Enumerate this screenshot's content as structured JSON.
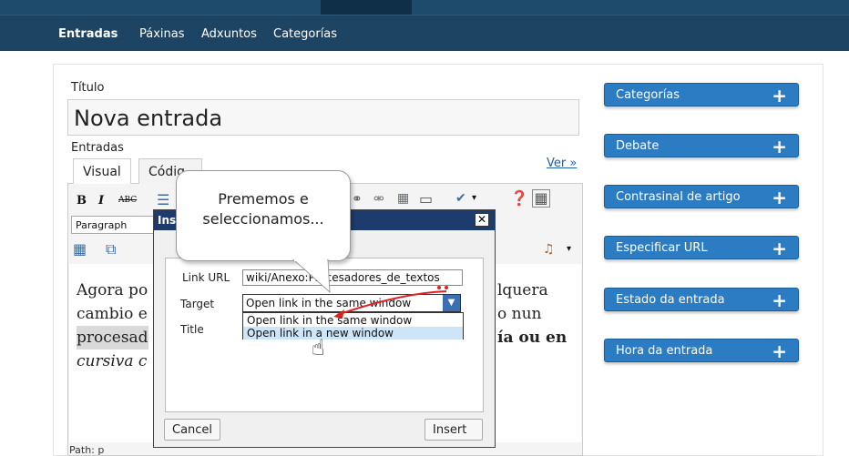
{
  "nav": {
    "items": [
      {
        "label": "Entradas"
      },
      {
        "label": "Páxinas"
      },
      {
        "label": "Adxuntos"
      },
      {
        "label": "Categorías"
      }
    ]
  },
  "post": {
    "title_label": "Título",
    "title_value": "Nova entrada",
    "content_label": "Entradas",
    "preview_link": "Ver »"
  },
  "editor": {
    "tabs": [
      "Visual",
      "Códig"
    ],
    "format_select": "Paragraph",
    "body_lines": [
      "Agora po",
      "cambio e",
      "procesad",
      "cursiva c"
    ],
    "body_right_lines": [
      "lquera",
      "o nun",
      "ía ou en"
    ],
    "path_label": "Path: p"
  },
  "sidebar": {
    "boxes": [
      {
        "label": "Categorías"
      },
      {
        "label": "Debate"
      },
      {
        "label": "Contrasinal de artigo"
      },
      {
        "label": "Especificar URL"
      },
      {
        "label": "Estado da entrada"
      },
      {
        "label": "Hora da entrada"
      }
    ]
  },
  "dialog": {
    "title": "Ins",
    "link_url_label": "Link URL",
    "link_url_value": "wiki/Anexo:Procesadores_de_textos",
    "target_label": "Target",
    "target_value": "Open link in the same window",
    "title_label": "Title",
    "options": [
      "Open link in the same window",
      "Open link in a new window"
    ],
    "cancel_label": "Cancel",
    "insert_label": "Insert",
    "close_glyph": "✕"
  },
  "callout": {
    "line1": "Prememos e",
    "line2": "seleccionamos..."
  },
  "colors": {
    "nav_bg": "#1d4462",
    "sidebar_box": "#2c7cc3",
    "dialog_title": "#1e3b6e",
    "link": "#1e5ea8",
    "arrow": "#e02020"
  }
}
